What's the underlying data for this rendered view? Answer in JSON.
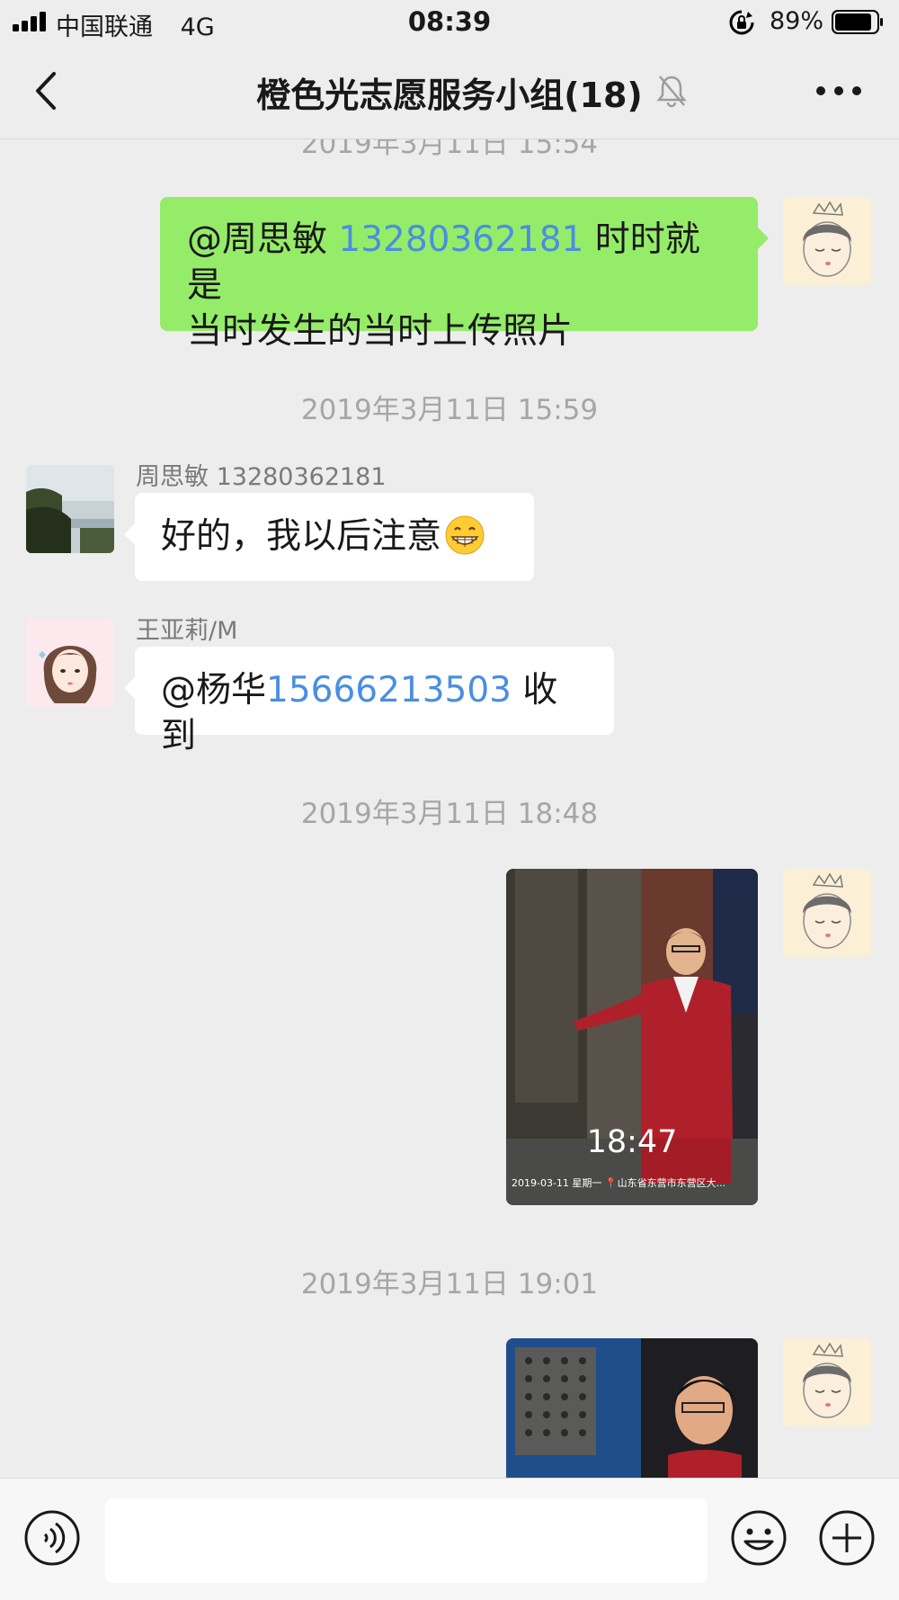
{
  "status_bar": {
    "carrier": "中国联通",
    "network": "4G",
    "time": "08:39",
    "battery_percent": "89%",
    "battery_level": 0.89
  },
  "nav": {
    "title": "橙色光志愿服务小组(18)",
    "back_icon": "chevron-left-icon",
    "mute_icon": "bell-off-icon",
    "more_icon": "more-dots-icon"
  },
  "messages": {
    "ts_top": "2019年3月11日 15:54",
    "msg1": {
      "mention": "@周思敏",
      "phone": "13280362181",
      "text_line1_tail": "时时就是",
      "text_line2": "当时发生的当时上传照片"
    },
    "ts2": "2019年3月11日 15:59",
    "msg2": {
      "sender": "周思敏 13280362181",
      "text": "好的，我以后注意",
      "emoji": "grinning-face-icon"
    },
    "msg3": {
      "sender": "王亚莉/M",
      "mention": "@杨华",
      "phone": "15666213503",
      "text": "收到"
    },
    "ts3": "2019年3月11日 18:48",
    "photo1": {
      "time": "18:47",
      "caption": "2019-03-11   星期一 📍山东省东营市东营区大..."
    },
    "ts4": "2019年3月11日 19:01"
  },
  "input_bar": {
    "placeholder": "",
    "voice_icon": "voice-icon",
    "emoji_icon": "smiley-icon",
    "plus_icon": "plus-circle-icon"
  },
  "colors": {
    "background": "#ededed",
    "bubble_out": "#95ec69",
    "bubble_in": "#ffffff",
    "link": "#4a8ee0",
    "timestamp": "#a6a6a6"
  }
}
